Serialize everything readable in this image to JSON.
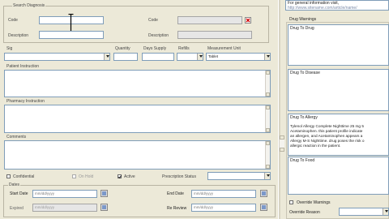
{
  "search": {
    "group_label": "Search Diagnosis",
    "code_label": "Code",
    "code_value": "",
    "description_label": "Description",
    "description_value": "",
    "right_code_label": "Code",
    "right_description_label": "Description"
  },
  "sig": {
    "sig_label": "Sig",
    "quantity_label": "Quantity",
    "days_supply_label": "Days Supply",
    "refills_label": "Refills",
    "measurement_unit_label": "Measurement Unit",
    "measurement_unit_value": "Tablet"
  },
  "sections": {
    "patient_instruction_label": "Patient Instruction",
    "pharmacy_instruction_label": "Pharmacy Instruction",
    "comments_label": "Comments"
  },
  "options": {
    "confidential_label": "Confidential",
    "on_hold_label": "On Hold",
    "active_label": "Active",
    "active_checked": true,
    "prescription_status_label": "Prescription Status"
  },
  "dates": {
    "group_label": "Dates",
    "start_date_label": "Start Date",
    "start_date_value": "mm/dd/yyyy",
    "end_date_label": "End Date",
    "end_date_value": "mm/dd/yyyy",
    "expired_label": "Expired",
    "expired_value": "mm/dd/yyyy",
    "re_review_label": "Re Review",
    "re_review_value": "mm/dd/yyyy"
  },
  "right": {
    "info_line1": "For general information visit,",
    "info_line2": "http://www.sitename.com/article/name/",
    "drug_warnings_label": "Drug Warnings",
    "drug_to_drug_label": "Drug To Drug",
    "drug_to_disease_label": "Drug To Disease",
    "drug_to_allergy_label": "Drug To Allergy",
    "allergy_lines": [
      "Tylenol Allergy Complete Nighttime 25 mg 5",
      "Acetaminophen. this patient profile indicate",
      "an allergen, and Acetaminophen appears a",
      "Allergy M-S Nighttime. drug poses the risk o",
      "allergic reaction in the patient."
    ],
    "drug_to_food_label": "Drug To Food",
    "override_warnings_label": "Override Warnings",
    "override_reason_label": "Override Reason"
  }
}
